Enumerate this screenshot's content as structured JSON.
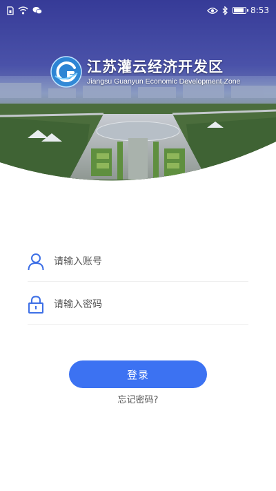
{
  "status_bar": {
    "time": "8:53",
    "left_icons": [
      "sim-icon",
      "wifi-icon",
      "wechat-icon"
    ],
    "right_icons": [
      "eye-icon",
      "bluetooth-icon",
      "battery-icon"
    ],
    "battery_level": 0.85
  },
  "header": {
    "title_cn": "江苏灌云经济开发区",
    "title_en": "Jiangsu Guanyun Economic Development Zone",
    "logo_letter": "G"
  },
  "form": {
    "account_placeholder": "请输入账号",
    "password_placeholder": "请输入密码",
    "login_label": "登录",
    "forgot_label": "忘记密码?"
  },
  "colors": {
    "primary": "#3c72f2",
    "icon": "#3d6fe6"
  }
}
